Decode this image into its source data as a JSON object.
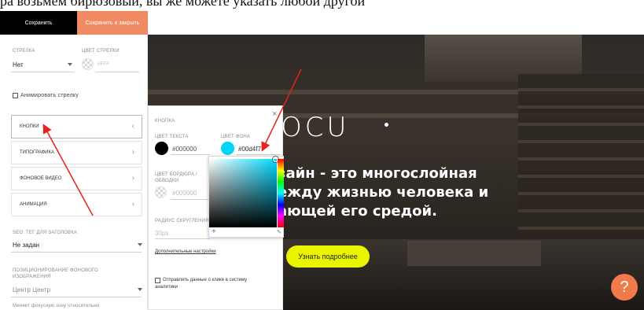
{
  "doc_line": "ра возьмем бирюзовый, вы же можете указать любой другой",
  "toolbar": {
    "save_label": "Сохранить",
    "save_close_label": "Сохранить и закрыть"
  },
  "left": {
    "arrow_caption": "СТРЕЛКА",
    "arrow_value": "Нет",
    "arrow_color_caption": "ЦВЕТ СТРЕЛКИ",
    "arrow_color_value": "#fff",
    "animate_label": "Анимировать стрелку",
    "menu": [
      "КНОПКИ",
      "ТИПОГРАФИКА",
      "ФОНОВОЕ ВИДЕО",
      "АНИМАЦИЯ"
    ],
    "seo_caption": "SEO: ТЕГ ДЛЯ ЗАГОЛОВКА",
    "seo_value": "Не задан",
    "bgpos_caption": "ПОЗИЦИОНИРОВАНИЕ ФОНОВОГО ИЗОБРАЖЕНИЯ",
    "bgpos_value": "Центр Центр",
    "bgpos_hint": "Меняет фокусную зону относительно"
  },
  "button_panel": {
    "title": "КНОПКА",
    "text_color_caption": "ЦВЕТ ТЕКСТА",
    "text_color_value": "#000000",
    "bg_color_caption": "ЦВЕТ ФОНА",
    "bg_color_value": "#00d4f7",
    "border_caption_1": "ЦВЕТ БОРДЮРА /",
    "border_caption_2": "ОБВОДКИ",
    "border_value": "#000000",
    "radius_caption": "РАДИУС СКРУГЛЕНИЯ",
    "radius_value": "30px",
    "advanced_label": "Дополнительные настройки",
    "send_data_label_1": "Отправлять данные о клике в систему",
    "send_data_label_2": "аналитики"
  },
  "picker": {
    "plus": "+",
    "dropper": "✎"
  },
  "hero": {
    "logo": "IOCU",
    "headline": "зайн - это многослойная\nежду жизнью человека и\nающей его средой.",
    "cta_label": "Узнать подробнее",
    "help_label": "?"
  },
  "colors": {
    "accent_orange": "#f08a62",
    "cta_yellow": "#e9f500",
    "picked_cyan": "#00d4f7",
    "arrow_red": "#e8211a"
  },
  "icons": {
    "chevron": "‹",
    "chevron_right": "›",
    "close": "×"
  }
}
